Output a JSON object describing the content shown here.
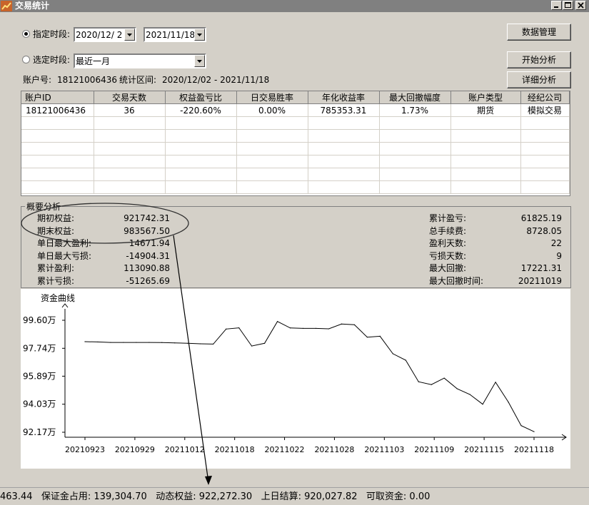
{
  "window": {
    "title": "交易统计"
  },
  "filters": {
    "specified_period_label": "指定时段:",
    "start_date": "2020/12/ 2",
    "end_date": "2021/11/18",
    "preset_period_label": "选定时段:",
    "preset_value": "最近一月"
  },
  "buttons": {
    "data_manage": "数据管理",
    "start_analysis": "开始分析",
    "detail_analysis": "详细分析"
  },
  "account_info": {
    "account_label": "账户号:",
    "account_no": "18121006436",
    "range_label": "统计区间:",
    "range": "2020/12/02 - 2021/11/18"
  },
  "table": {
    "columns": [
      "账户ID",
      "交易天数",
      "权益盈亏比",
      "日交易胜率",
      "年化收益率",
      "最大回撤幅度",
      "账户类型",
      "经纪公司"
    ],
    "rows": [
      [
        "18121006436",
        "36",
        "-220.60%",
        "0.00%",
        "785353.31",
        "1.73%",
        "期货",
        "模拟交易"
      ]
    ]
  },
  "summary": {
    "title": "概要分析",
    "left": [
      {
        "label": "期初权益:",
        "value": "921742.31"
      },
      {
        "label": "期末权益:",
        "value": "983567.50"
      },
      {
        "label": "单日最大盈利:",
        "value": "14671.94"
      },
      {
        "label": "单日最大亏损:",
        "value": "-14904.31"
      },
      {
        "label": "累计盈利:",
        "value": "113090.88"
      },
      {
        "label": "累计亏损:",
        "value": "-51265.69"
      }
    ],
    "right": [
      {
        "label": "累计盈亏:",
        "value": "61825.19"
      },
      {
        "label": "总手续费:",
        "value": "8728.05"
      },
      {
        "label": "盈利天数:",
        "value": "22"
      },
      {
        "label": "亏损天数:",
        "value": "9"
      },
      {
        "label": "最大回撤:",
        "value": "17221.31"
      },
      {
        "label": "最大回撤时间:",
        "value": "20211019"
      }
    ]
  },
  "chart_data": {
    "type": "line",
    "title": "资金曲线",
    "y_ticks": [
      "99.60万",
      "97.74万",
      "95.89万",
      "94.03万",
      "92.17万"
    ],
    "y_tick_values": [
      996000,
      977400,
      958900,
      940300,
      921700
    ],
    "x_ticks": [
      "20210923",
      "20210929",
      "20211012",
      "20211018",
      "20211022",
      "20211028",
      "20211103",
      "20211109",
      "20211115",
      "20211118"
    ],
    "series": [
      {
        "values": [
          981800,
          981600,
          981300,
          981300,
          981300,
          981300,
          981200,
          981000,
          980700,
          980400,
          980200,
          990200,
          991000,
          978900,
          980700,
          995200,
          990900,
          990600,
          990600,
          990300,
          993500,
          993000,
          984800,
          985400,
          973800,
          969500,
          955200,
          953300,
          957600,
          950600,
          946800,
          940300,
          954900,
          941700,
          926100,
          922100
        ]
      }
    ]
  },
  "annotation": {
    "ellipse_color": "#303030",
    "arrow_color": "#000000"
  },
  "status": {
    "text": "463.44   保证金占用: 139,304.70   动态权益: 922,272.30   上日结算: 920,027.82   可取资金: 0.00"
  }
}
